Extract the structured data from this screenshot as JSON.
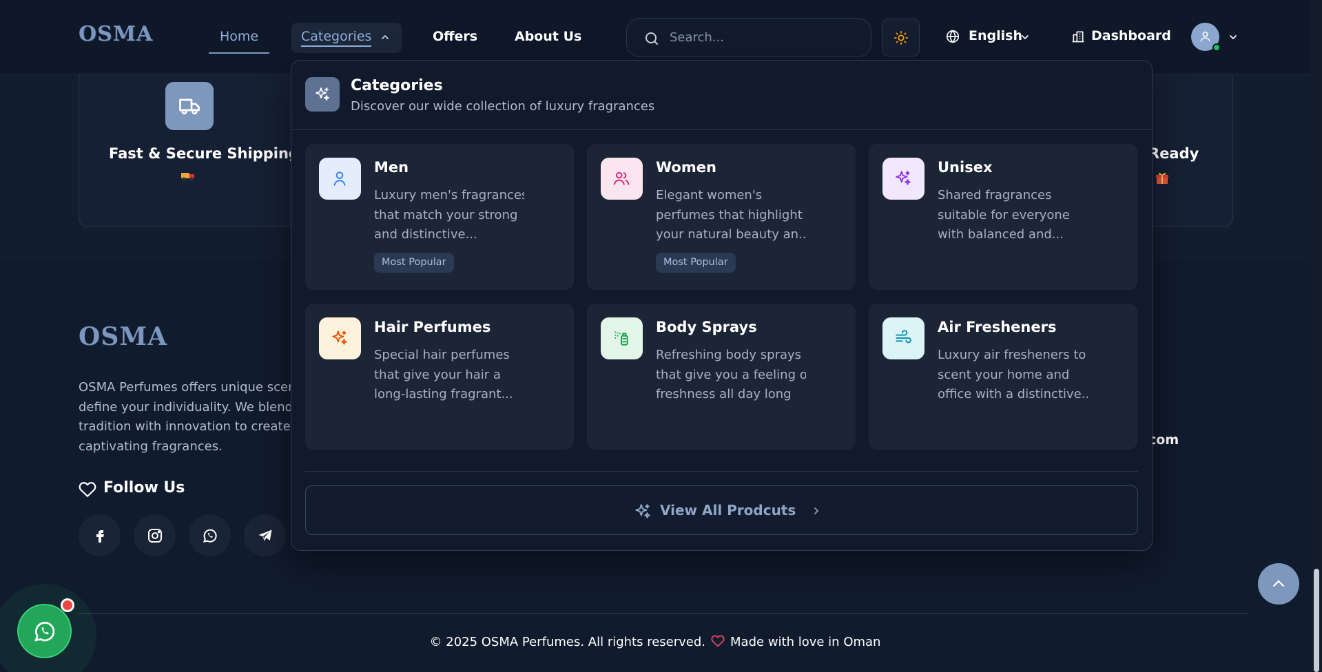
{
  "header": {
    "logo": "OSMA",
    "nav": {
      "home": "Home",
      "categories": "Categories",
      "offers": "Offers",
      "about": "About Us"
    },
    "search_placeholder": "Search...",
    "language": "English",
    "dashboard": "Dashboard"
  },
  "features": {
    "shipping_title": "Fast & Secure Shipping",
    "shipping_emoji": "🚚",
    "ready_title_fragment": "Ready",
    "ready_emoji": "🎁"
  },
  "footer": {
    "logo": "OSMA",
    "description_lines": [
      "OSMA Perfumes offers unique scent",
      "define your individuality. We blend",
      "tradition with innovation to create",
      "captivating fragrances."
    ],
    "follow_us": "Follow Us",
    "email_fragment": "com",
    "copyright": "© 2025 OSMA Perfumes. All rights reserved.",
    "made_with": "Made with love in Oman"
  },
  "dropdown": {
    "title": "Categories",
    "subtitle": "Discover our wide collection of luxury fragrances",
    "categories": [
      {
        "name": "Men",
        "desc": [
          "Luxury men's fragrances",
          "that match your strong",
          "and distinctive..."
        ],
        "badge": "Most Popular",
        "icon": "user-icon",
        "color": "#3b82f6",
        "bg": "#e3edfb"
      },
      {
        "name": "Women",
        "desc": [
          "Elegant women's",
          "perfumes that highlight",
          "your natural beauty an..."
        ],
        "badge": "Most Popular",
        "icon": "users-icon",
        "color": "#db2777",
        "bg": "#fbe6ef"
      },
      {
        "name": "Unisex",
        "desc": [
          "Shared fragrances",
          "suitable for everyone",
          "with balanced and..."
        ],
        "badge": "",
        "icon": "sparkles-icon",
        "color": "#9333ea",
        "bg": "#f1e8fb"
      },
      {
        "name": "Hair Perfumes",
        "desc": [
          "Special hair perfumes",
          "that give your hair a",
          "long-lasting fragrant..."
        ],
        "badge": "",
        "icon": "sparkles-icon",
        "color": "#ea580c",
        "bg": "#fdf2dc"
      },
      {
        "name": "Body Sprays",
        "desc": [
          "Refreshing body sprays",
          "that give you a feeling of",
          "freshness all day long"
        ],
        "badge": "",
        "icon": "spray-icon",
        "color": "#16a34a",
        "bg": "#e2f5e8"
      },
      {
        "name": "Air Fresheners",
        "desc": [
          "Luxury air fresheners to",
          "scent your home and",
          "office with a distinctive..."
        ],
        "badge": "",
        "icon": "wind-icon",
        "color": "#0891b2",
        "bg": "#dcf3f7"
      }
    ],
    "view_all": "View All Prodcuts"
  },
  "colors": {
    "accent": "#7c97bd",
    "background": "#111b2e",
    "whatsapp": "#22a75a"
  }
}
